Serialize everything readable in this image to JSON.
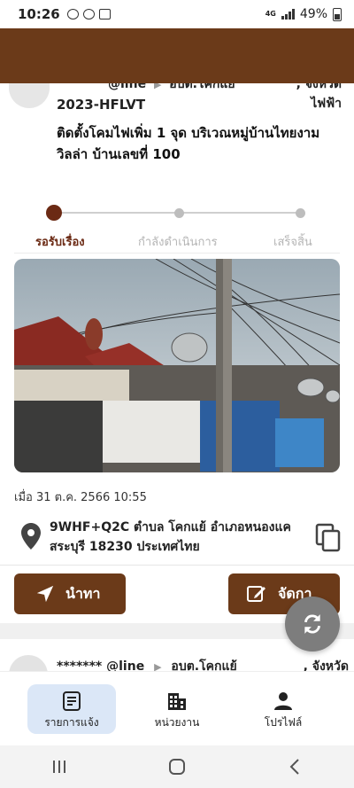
{
  "status_bar": {
    "time": "10:26",
    "network": "4G",
    "battery": "49%"
  },
  "card": {
    "meta_user": "@line",
    "meta_org": "อบต.โคกแย้",
    "meta_province": ", จังหวัด",
    "meta_category": "ไฟฟ้า",
    "ticket_id": "2023-HFLVT",
    "description": "ติดตั้งโคมไฟเพิ่ม 1 จุด บริเวณหมู่บ้านไทยงามวิลล่า บ้านเลขที่ 100",
    "steps": [
      {
        "label": "รอรับเรื่อง",
        "state": "active"
      },
      {
        "label": "กำลังดำเนินการ",
        "state": "pending"
      },
      {
        "label": "เสร็จสิ้น",
        "state": "pending"
      }
    ],
    "date": "เมื่อ 31 ต.ค. 2566 10:55",
    "address": "9WHF+Q2C ตำบล โคกแย้ อำเภอหนองแค สระบุรี 18230 ประเทศไทย",
    "navigate_label": "นำทา",
    "manage_label": "จัดกา"
  },
  "next_item": {
    "user": "******* @line",
    "org": "อบต.โคกแย้",
    "province": ", จังหวัด"
  },
  "bottom_nav": {
    "items": [
      {
        "label": "รายการแจ้ง",
        "icon": "list-icon",
        "active": true
      },
      {
        "label": "หน่วยงาน",
        "icon": "building-icon",
        "active": false
      },
      {
        "label": "โปรไฟล์",
        "icon": "person-icon",
        "active": false
      }
    ]
  },
  "colors": {
    "brand_brown": "#6b3a19",
    "step_active": "#6b2a14",
    "nav_active_bg": "#dbe7f7"
  }
}
